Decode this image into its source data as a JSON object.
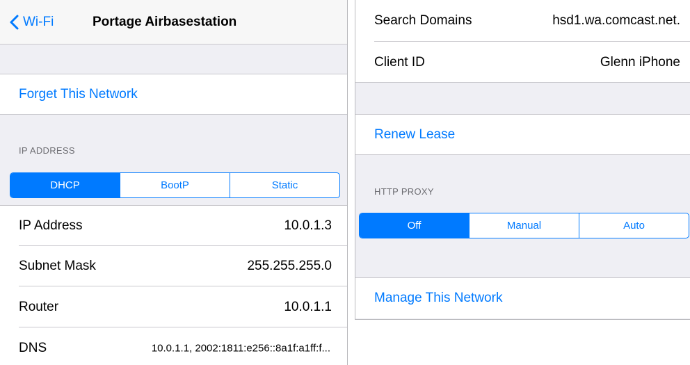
{
  "colors": {
    "accent": "#007aff",
    "group_bg": "#efeff4",
    "separator": "#c8c7cc",
    "header_text": "#6d6d72"
  },
  "left": {
    "nav": {
      "back_label": "Wi-Fi",
      "back_icon": "chevron-left-icon",
      "title": "Portage Airbasestation"
    },
    "forget_label": "Forget This Network",
    "ip_header": "IP ADDRESS",
    "ip_mode": {
      "options": [
        "DHCP",
        "BootP",
        "Static"
      ],
      "selected": "DHCP"
    },
    "rows": [
      {
        "label": "IP Address",
        "value": "10.0.1.3"
      },
      {
        "label": "Subnet Mask",
        "value": "255.255.255.0"
      },
      {
        "label": "Router",
        "value": "10.0.1.1"
      },
      {
        "label": "DNS",
        "value": "10.0.1.1, 2002:1811:e256::8a1f:a1ff:f..."
      }
    ]
  },
  "right": {
    "rows": [
      {
        "label": "Search Domains",
        "value": "hsd1.wa.comcast.net."
      },
      {
        "label": "Client ID",
        "value": "Glenn iPhone"
      }
    ],
    "renew_label": "Renew Lease",
    "proxy_header": "HTTP PROXY",
    "proxy_mode": {
      "options": [
        "Off",
        "Manual",
        "Auto"
      ],
      "selected": "Off"
    },
    "manage_label": "Manage This Network"
  }
}
